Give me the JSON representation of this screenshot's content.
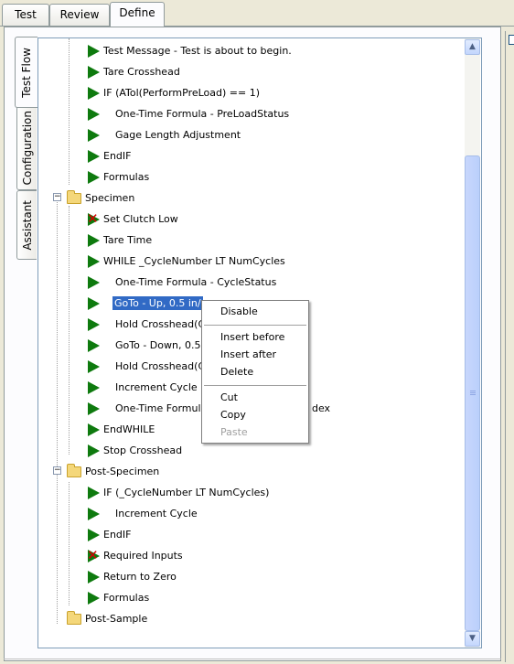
{
  "tabs": [
    "Test",
    "Review",
    "Define"
  ],
  "active_tab": "Define",
  "side_tabs": [
    "Test Flow",
    "Configuration",
    "Assistant"
  ],
  "active_side_tab": "Test Flow",
  "tree": {
    "items": [
      "Test Message - Test is about to begin.",
      "Tare Crosshead",
      "IF (ATol(PerformPreLoad) == 1)",
      "One-Time Formula - PreLoadStatus",
      "Gage Length Adjustment",
      "EndIF",
      "Formulas",
      "Specimen",
      "Set Clutch Low",
      "Tare Time",
      "WHILE _CycleNumber LT NumCycles",
      "One-Time Formula - CycleStatus",
      "GoTo - Up, 0.5 in/",
      "Hold Crosshead(C",
      "GoTo - Down, 0.5",
      "Hold Crosshead(C",
      "Increment Cycle",
      "One-Time Formula",
      "EndWHILE",
      "Stop Crosshead",
      "Post-Specimen",
      "IF (_CycleNumber LT NumCycles)",
      "Increment Cycle",
      "EndIF",
      "Required Inputs",
      "Return to Zero",
      "Formulas",
      "Post-Sample"
    ],
    "hidden_fragment": "dex",
    "selected_item": "GoTo - Up, 0.5 in/"
  },
  "context_menu": {
    "items": [
      "Disable",
      "Insert before",
      "Insert after",
      "Delete",
      "Cut",
      "Copy",
      "Paste"
    ],
    "disabled": [
      "Paste"
    ]
  },
  "scrollbar": {
    "up_glyph": "▲",
    "down_glyph": "▼"
  },
  "colors": {
    "accent_selection": "#316ac5",
    "play_icon": "#0e7a0e",
    "disabled_x": "#d40000",
    "folder": "#f4d77a"
  }
}
